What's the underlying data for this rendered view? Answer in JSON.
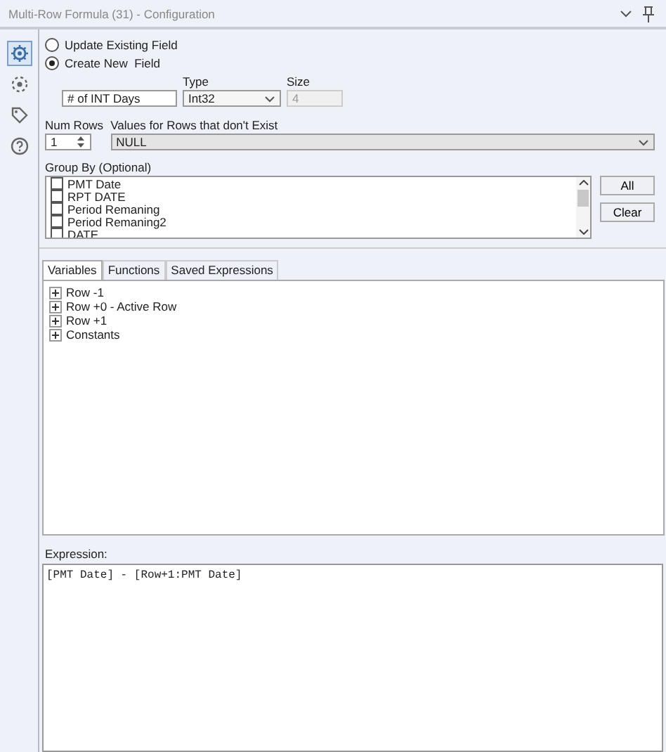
{
  "window": {
    "title": "Multi-Row Formula (31) - Configuration"
  },
  "sidebar": {
    "items": [
      {
        "kind": "gear",
        "selected": true
      },
      {
        "kind": "dots",
        "selected": false
      },
      {
        "kind": "tag",
        "selected": false
      },
      {
        "kind": "help",
        "selected": false
      }
    ]
  },
  "field_mode": [
    {
      "label": "Update Existing Field",
      "selected": false
    },
    {
      "label": "Create New  Field",
      "selected": true
    }
  ],
  "new_field": {
    "name": "# of INT Days",
    "type_label": "Type",
    "type": "Int32",
    "size_label": "Size",
    "size": "4",
    "size_disabled": true
  },
  "num_rows": {
    "label": "Num Rows",
    "value": "1"
  },
  "missing_rows": {
    "label": "Values for Rows that don't Exist",
    "value": "NULL"
  },
  "group_by": {
    "label": "Group By (Optional)",
    "items": [
      {
        "label": "PMT Date",
        "checked": false
      },
      {
        "label": "RPT DATE",
        "checked": false
      },
      {
        "label": "Period Remaning",
        "checked": false
      },
      {
        "label": "Period Remaning2",
        "checked": false
      },
      {
        "label": "DATE",
        "checked": false
      }
    ],
    "buttons": [
      "All",
      "Clear"
    ]
  },
  "tabs": [
    {
      "label": "Variables",
      "selected": true
    },
    {
      "label": "Functions",
      "selected": false
    },
    {
      "label": "Saved Expressions",
      "selected": false
    }
  ],
  "tree": [
    {
      "label": "Row -1",
      "expanded": false
    },
    {
      "label": "Row +0 - Active Row",
      "expanded": false
    },
    {
      "label": "Row +1",
      "expanded": false
    },
    {
      "label": "Constants",
      "expanded": false
    }
  ],
  "expression": {
    "label": "Expression:",
    "value": "[PMT Date] - [Row+1:PMT Date]"
  }
}
